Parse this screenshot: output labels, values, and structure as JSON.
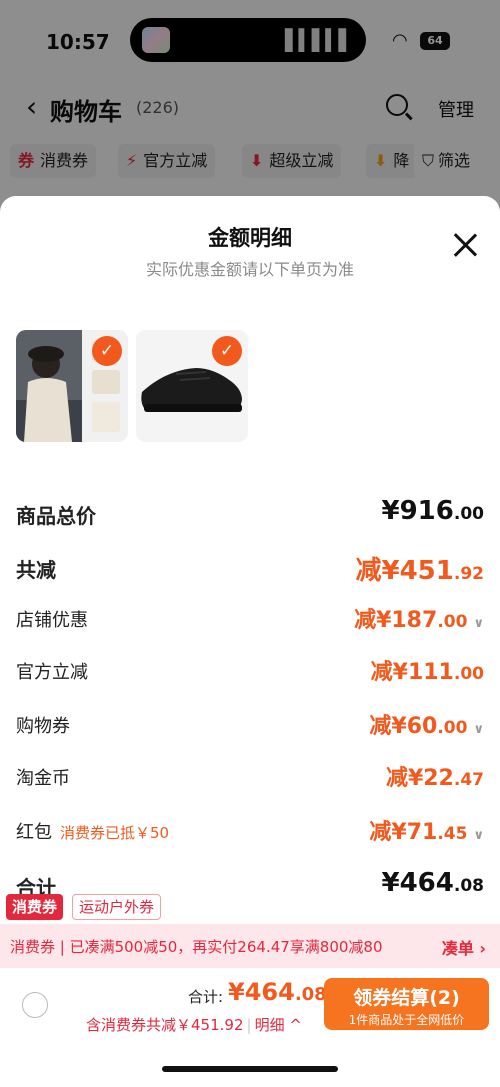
{
  "status_bar": {
    "time": "10:57",
    "battery": "64"
  },
  "nav": {
    "title": "购物车",
    "count": "(226)",
    "manage": "管理"
  },
  "filters": [
    {
      "icon": "券",
      "label": "消费券"
    },
    {
      "icon": "⚡",
      "label": "官方立减"
    },
    {
      "icon": "⬇",
      "label": "超级立减"
    },
    {
      "icon": "⬇",
      "label": "降"
    },
    {
      "icon": "⛉",
      "label": "筛选"
    }
  ],
  "sheet": {
    "title": "金额明细",
    "subtitle": "实际优惠金额请以下单页为准"
  },
  "details": {
    "goods_total": {
      "label": "商品总价",
      "prefix": "¥",
      "int": "916",
      "dec": ".00"
    },
    "total_reduce": {
      "label": "共减",
      "prefix": "减¥",
      "int": "451",
      "dec": ".92"
    },
    "shop_discount": {
      "label": "店铺优惠",
      "prefix": "减¥",
      "int": "187",
      "dec": ".00"
    },
    "official_cut": {
      "label": "官方立减",
      "prefix": "减¥",
      "int": "111",
      "dec": ".00"
    },
    "shopping_coupon": {
      "label": "购物券",
      "prefix": "减¥",
      "int": "60",
      "dec": ".00"
    },
    "taojinbi": {
      "label": "淘金币",
      "prefix": "减¥",
      "int": "22",
      "dec": ".47"
    },
    "red_packet": {
      "label": "红包",
      "note": "消费券已抵￥50",
      "prefix": "减¥",
      "int": "71",
      "dec": ".45"
    },
    "sum": {
      "label": "合计",
      "prefix": "¥",
      "int": "464",
      "dec": ".08"
    }
  },
  "tags": {
    "tag1": "消费券",
    "tag2": "运动户外券"
  },
  "promo": {
    "text": "消费券 | 已凑满500减50，再实付264.47享满800减80",
    "link": "凑单 ›"
  },
  "footer": {
    "total_label": "合计:",
    "total_prefix": "¥",
    "total_int": "464",
    "total_dec": ".08",
    "sub_text": "含消费券共减￥451.92",
    "detail_label": "明细",
    "checkout_label": "领券结算(2)",
    "checkout_sub": "1件商品处于全网低价"
  }
}
